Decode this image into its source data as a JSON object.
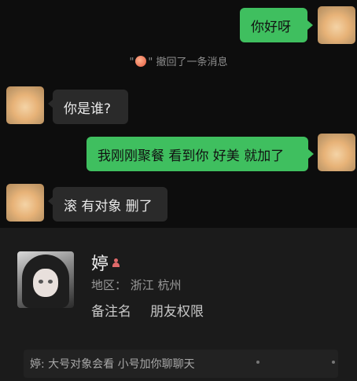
{
  "messages": [
    {
      "side": "out",
      "text": "你好呀"
    },
    {
      "side": "system",
      "prefix": "\"",
      "suffix": "\" 撤回了一条消息"
    },
    {
      "side": "in",
      "text": "你是谁?"
    },
    {
      "side": "out",
      "text": "我刚刚聚餐 看到你 好美 就加了"
    },
    {
      "side": "in",
      "text": "滚 有对象 删了"
    }
  ],
  "profile": {
    "name": "婷",
    "gender_icon": "female-icon",
    "region": "地区：  浙江 杭州",
    "links": [
      "备注名",
      "朋友权限"
    ],
    "moment_preview": "婷: 大号对象会看 小号加你聊聊天"
  }
}
